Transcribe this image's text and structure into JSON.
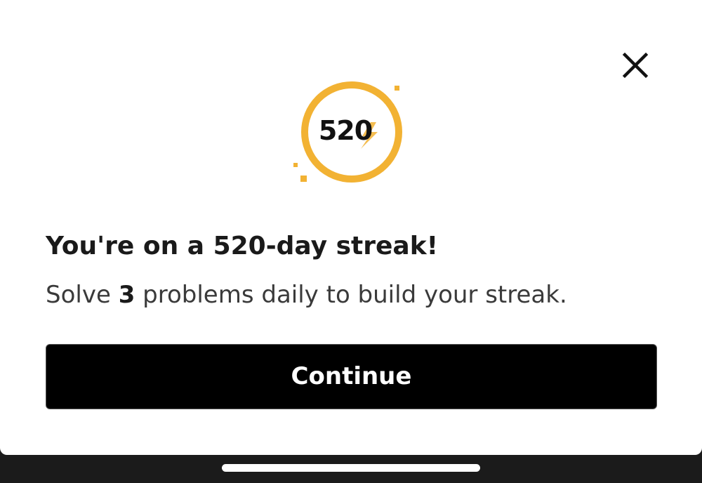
{
  "dialog": {
    "close_icon": "close-icon",
    "streak_count": "520",
    "streak_badge_icon": "lightning-bolt-icon",
    "title": "You're on a 520-day streak!",
    "subtitle_prefix": "Solve ",
    "subtitle_count": "3",
    "subtitle_suffix": " problems daily to build your streak.",
    "continue_label": "Continue"
  },
  "colors": {
    "accent": "#F2B233",
    "button_bg": "#000000",
    "button_text": "#FFFFFF",
    "title_text": "#1A1A1A",
    "background": "#FFFFFF"
  },
  "system": {
    "home_indicator": "home-indicator"
  }
}
